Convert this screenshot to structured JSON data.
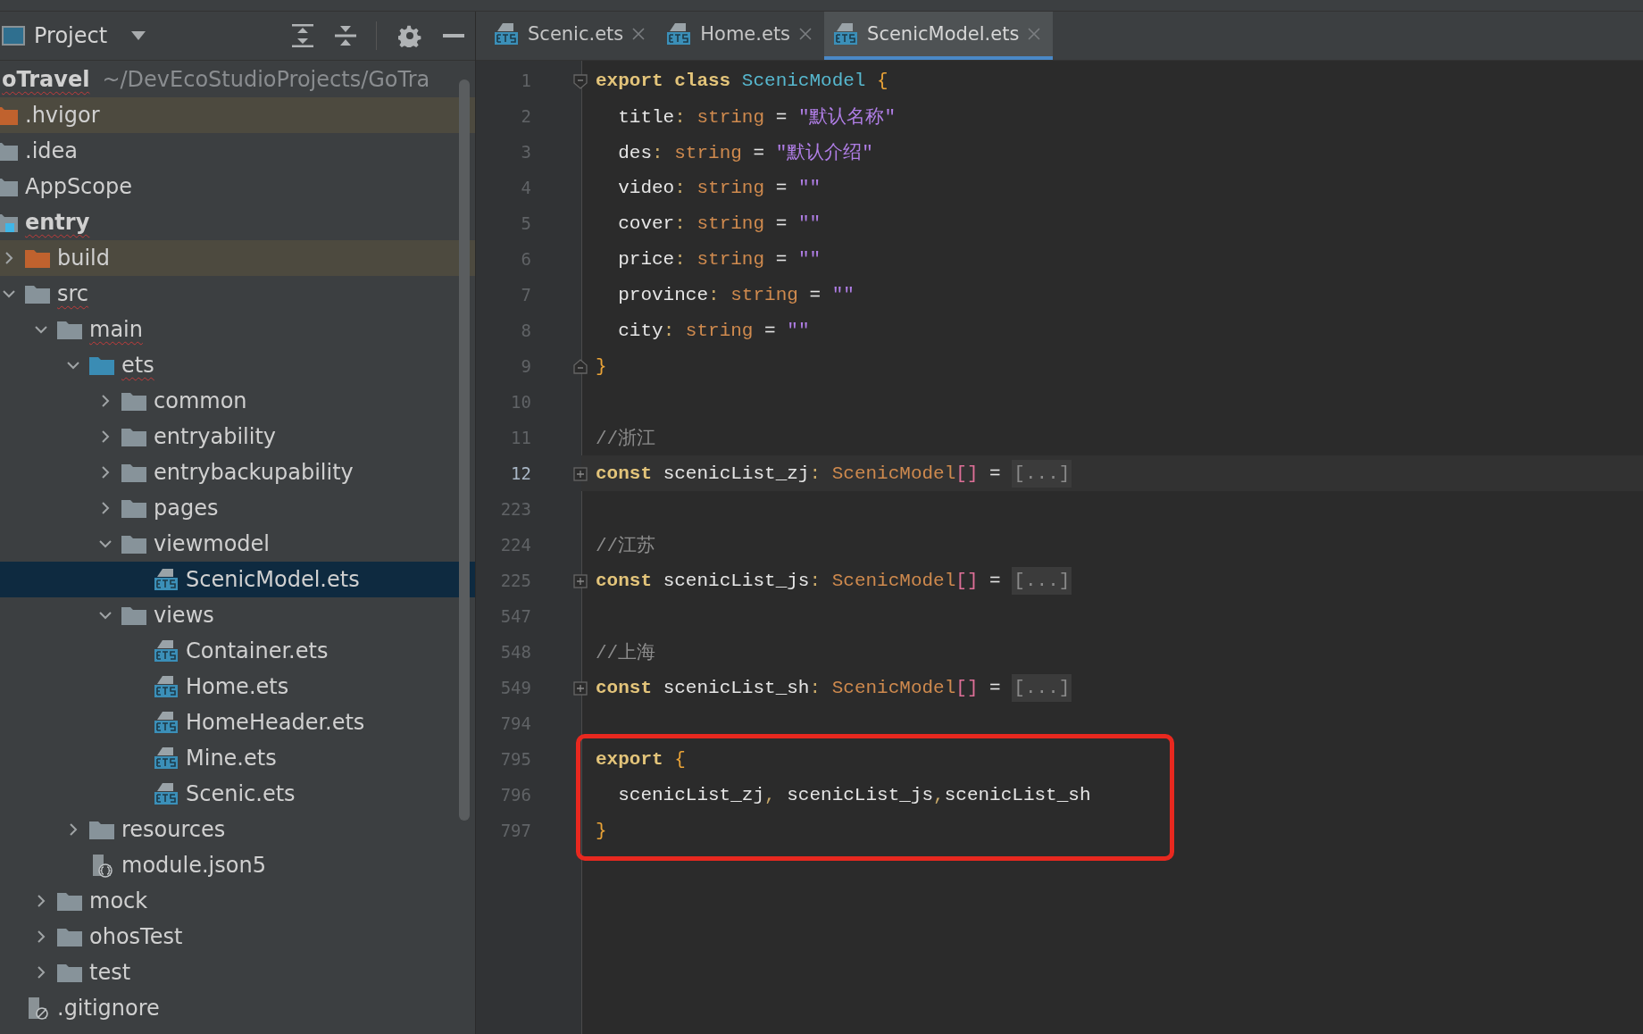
{
  "project_panel": {
    "title": "Project",
    "root": {
      "label": "oTravel",
      "path": "~/DevEcoStudioProjects/GoTra",
      "misspelled": true,
      "children": [
        {
          "label": ".hvigor",
          "kind": "excluded-folder",
          "excluded": true,
          "selected": false
        },
        {
          "label": ".idea",
          "kind": "folder",
          "selected": false
        },
        {
          "label": "AppScope",
          "kind": "folder",
          "selected": false
        },
        {
          "label": "entry",
          "kind": "module",
          "misspelled": true,
          "selected": false,
          "children": [
            {
              "label": "build",
              "kind": "excluded-folder",
              "excluded": true,
              "expanded": false,
              "selected": false
            },
            {
              "label": "src",
              "kind": "folder",
              "misspelled": true,
              "expanded": true,
              "selected": false,
              "children": [
                {
                  "label": "main",
                  "kind": "folder",
                  "misspelled": true,
                  "expanded": true,
                  "selected": false,
                  "children": [
                    {
                      "label": "ets",
                      "kind": "source-folder",
                      "misspelled": true,
                      "expanded": true,
                      "selected": false,
                      "children": [
                        {
                          "label": "common",
                          "kind": "folder",
                          "expanded": false,
                          "selected": false
                        },
                        {
                          "label": "entryability",
                          "kind": "folder",
                          "expanded": false,
                          "selected": false
                        },
                        {
                          "label": "entrybackupability",
                          "kind": "folder",
                          "expanded": false,
                          "selected": false
                        },
                        {
                          "label": "pages",
                          "kind": "folder",
                          "expanded": false,
                          "selected": false
                        },
                        {
                          "label": "viewmodel",
                          "kind": "folder",
                          "expanded": true,
                          "selected": false,
                          "children": [
                            {
                              "label": "ScenicModel.ets",
                              "kind": "ets-file",
                              "selected": true
                            }
                          ]
                        },
                        {
                          "label": "views",
                          "kind": "folder",
                          "expanded": true,
                          "selected": false,
                          "children": [
                            {
                              "label": "Container.ets",
                              "kind": "ets-file",
                              "selected": false
                            },
                            {
                              "label": "Home.ets",
                              "kind": "ets-file",
                              "selected": false
                            },
                            {
                              "label": "HomeHeader.ets",
                              "kind": "ets-file",
                              "selected": false
                            },
                            {
                              "label": "Mine.ets",
                              "kind": "ets-file",
                              "selected": false
                            },
                            {
                              "label": "Scenic.ets",
                              "kind": "ets-file",
                              "selected": false
                            }
                          ]
                        }
                      ]
                    },
                    {
                      "label": "resources",
                      "kind": "folder",
                      "expanded": false,
                      "selected": false
                    },
                    {
                      "label": "module.json5",
                      "kind": "json-file",
                      "selected": false
                    }
                  ]
                },
                {
                  "label": "mock",
                  "kind": "folder",
                  "expanded": false,
                  "selected": false
                },
                {
                  "label": "ohosTest",
                  "kind": "folder",
                  "expanded": false,
                  "selected": false
                },
                {
                  "label": "test",
                  "kind": "folder",
                  "expanded": false,
                  "selected": false
                }
              ]
            },
            {
              "label": ".gitignore",
              "kind": "ignore-file",
              "selected": false
            }
          ]
        }
      ]
    }
  },
  "tabs": [
    {
      "label": "Scenic.ets",
      "selected": false
    },
    {
      "label": "Home.ets",
      "selected": false
    },
    {
      "label": "ScenicModel.ets",
      "selected": true
    }
  ],
  "editor": {
    "lines": [
      {
        "number": "1",
        "kind": "fold-start",
        "current": false,
        "tokens": [
          {
            "kind": "keyword",
            "t": "export class "
          },
          {
            "kind": "class",
            "t": "ScenicModel "
          },
          {
            "kind": "brace",
            "t": "{"
          }
        ]
      },
      {
        "number": "2",
        "kind": "plain",
        "current": false,
        "tokens": [
          {
            "kind": "plain",
            "t": "  title"
          },
          {
            "kind": "colon",
            "t": ": "
          },
          {
            "kind": "type",
            "t": "string "
          },
          {
            "kind": "plain",
            "t": "= "
          },
          {
            "kind": "string",
            "t": "\"默认名称\""
          }
        ]
      },
      {
        "number": "3",
        "kind": "plain",
        "current": false,
        "tokens": [
          {
            "kind": "plain",
            "t": "  des"
          },
          {
            "kind": "colon",
            "t": ": "
          },
          {
            "kind": "type",
            "t": "string "
          },
          {
            "kind": "plain",
            "t": "= "
          },
          {
            "kind": "string",
            "t": "\"默认介绍\""
          }
        ]
      },
      {
        "number": "4",
        "kind": "plain",
        "current": false,
        "tokens": [
          {
            "kind": "plain",
            "t": "  video"
          },
          {
            "kind": "colon",
            "t": ": "
          },
          {
            "kind": "type",
            "t": "string "
          },
          {
            "kind": "plain",
            "t": "= "
          },
          {
            "kind": "string",
            "t": "\"\""
          }
        ]
      },
      {
        "number": "5",
        "kind": "plain",
        "current": false,
        "tokens": [
          {
            "kind": "plain",
            "t": "  cover"
          },
          {
            "kind": "colon",
            "t": ": "
          },
          {
            "kind": "type",
            "t": "string "
          },
          {
            "kind": "plain",
            "t": "= "
          },
          {
            "kind": "string",
            "t": "\"\""
          }
        ]
      },
      {
        "number": "6",
        "kind": "plain",
        "current": false,
        "tokens": [
          {
            "kind": "plain",
            "t": "  price"
          },
          {
            "kind": "colon",
            "t": ": "
          },
          {
            "kind": "type",
            "t": "string "
          },
          {
            "kind": "plain",
            "t": "= "
          },
          {
            "kind": "string",
            "t": "\"\""
          }
        ]
      },
      {
        "number": "7",
        "kind": "plain",
        "current": false,
        "tokens": [
          {
            "kind": "plain",
            "t": "  province"
          },
          {
            "kind": "colon",
            "t": ": "
          },
          {
            "kind": "type",
            "t": "string "
          },
          {
            "kind": "plain",
            "t": "= "
          },
          {
            "kind": "string",
            "t": "\"\""
          }
        ]
      },
      {
        "number": "8",
        "kind": "plain",
        "current": false,
        "tokens": [
          {
            "kind": "plain",
            "t": "  city"
          },
          {
            "kind": "colon",
            "t": ": "
          },
          {
            "kind": "type",
            "t": "string "
          },
          {
            "kind": "plain",
            "t": "= "
          },
          {
            "kind": "string",
            "t": "\"\""
          }
        ]
      },
      {
        "number": "9",
        "kind": "fold-end",
        "current": false,
        "tokens": [
          {
            "kind": "brace",
            "t": "}"
          }
        ]
      },
      {
        "number": "10",
        "kind": "plain",
        "current": false
      },
      {
        "number": "11",
        "kind": "plain",
        "current": false,
        "tokens": [
          {
            "kind": "comment",
            "t": "//浙江"
          }
        ]
      },
      {
        "number": "12",
        "kind": "collapsed",
        "current": true,
        "tokens": [
          {
            "kind": "keyword",
            "t": "const "
          },
          {
            "kind": "plain",
            "t": "scenicList_zj"
          },
          {
            "kind": "colon",
            "t": ": "
          },
          {
            "kind": "type",
            "t": "ScenicModel"
          },
          {
            "kind": "bracket",
            "t": "[] "
          },
          {
            "kind": "plain",
            "t": "= "
          },
          {
            "kind": "folded",
            "t": "[...]"
          }
        ]
      },
      {
        "number": "223",
        "kind": "plain",
        "current": false
      },
      {
        "number": "224",
        "kind": "plain",
        "current": false,
        "tokens": [
          {
            "kind": "comment",
            "t": "//江苏"
          }
        ]
      },
      {
        "number": "225",
        "kind": "collapsed",
        "current": false,
        "tokens": [
          {
            "kind": "keyword",
            "t": "const "
          },
          {
            "kind": "plain",
            "t": "scenicList_js"
          },
          {
            "kind": "colon",
            "t": ": "
          },
          {
            "kind": "type",
            "t": "ScenicModel"
          },
          {
            "kind": "bracket",
            "t": "[] "
          },
          {
            "kind": "plain",
            "t": "= "
          },
          {
            "kind": "folded",
            "t": "[...]"
          }
        ]
      },
      {
        "number": "547",
        "kind": "plain",
        "current": false
      },
      {
        "number": "548",
        "kind": "plain",
        "current": false,
        "tokens": [
          {
            "kind": "comment",
            "t": "//上海"
          }
        ]
      },
      {
        "number": "549",
        "kind": "collapsed",
        "current": false,
        "tokens": [
          {
            "kind": "keyword",
            "t": "const "
          },
          {
            "kind": "plain",
            "t": "scenicList_sh"
          },
          {
            "kind": "colon",
            "t": ": "
          },
          {
            "kind": "type",
            "t": "ScenicModel"
          },
          {
            "kind": "bracket",
            "t": "[] "
          },
          {
            "kind": "plain",
            "t": "= "
          },
          {
            "kind": "folded",
            "t": "[...]"
          }
        ]
      },
      {
        "number": "794",
        "kind": "plain",
        "current": false
      }
    ],
    "highlighted_lines": [
      {
        "number": "795",
        "current": false,
        "tokens": [
          {
            "kind": "keyword",
            "t": "export "
          },
          {
            "kind": "brace",
            "t": "{"
          }
        ]
      },
      {
        "number": "796",
        "current": false,
        "tokens": [
          {
            "kind": "plain",
            "t": "  scenicList_zj"
          },
          {
            "kind": "colon",
            "t": ", "
          },
          {
            "kind": "plain",
            "t": "scenicList_js"
          },
          {
            "kind": "colon",
            "t": ","
          },
          {
            "kind": "plain",
            "t": "scenicList_sh"
          }
        ]
      },
      {
        "number": "797",
        "current": false,
        "tokens": [
          {
            "kind": "brace",
            "t": "}"
          }
        ]
      }
    ]
  }
}
